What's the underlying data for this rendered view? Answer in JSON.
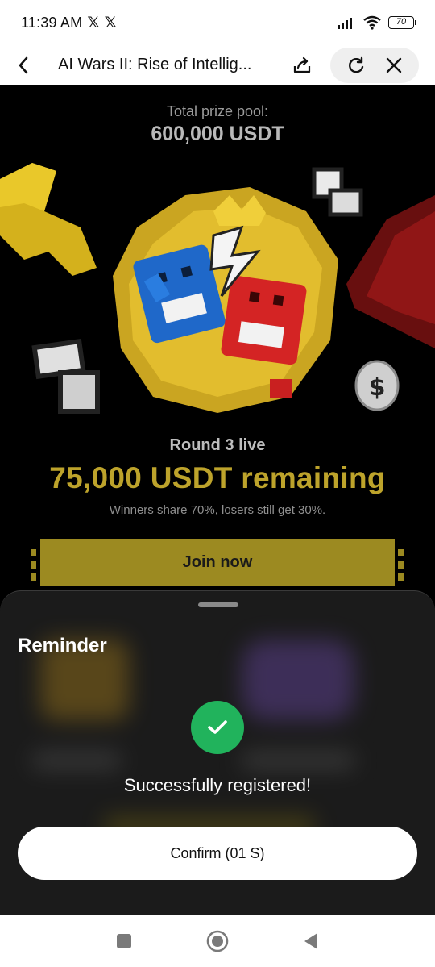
{
  "status_bar": {
    "time": "11:39 AM",
    "notif_icons": [
      "𝕏",
      "𝕏"
    ],
    "battery": "70"
  },
  "title_bar": {
    "title": "AI Wars II: Rise of Intellig..."
  },
  "main": {
    "prize_label": "Total prize pool:",
    "prize_value": "600,000 USDT",
    "round_label": "Round 3 live",
    "remaining": "75,000 USDT remaining",
    "share_note": "Winners share 70%, losers still get 30%.",
    "join_label": "Join now"
  },
  "sheet": {
    "title": "Reminder",
    "message": "Successfully registered!",
    "confirm_label": "Confirm (01 S)"
  },
  "colors": {
    "accent_gold": "#bda32b",
    "join_bg": "#9c8a21",
    "success_green": "#21b35c"
  }
}
